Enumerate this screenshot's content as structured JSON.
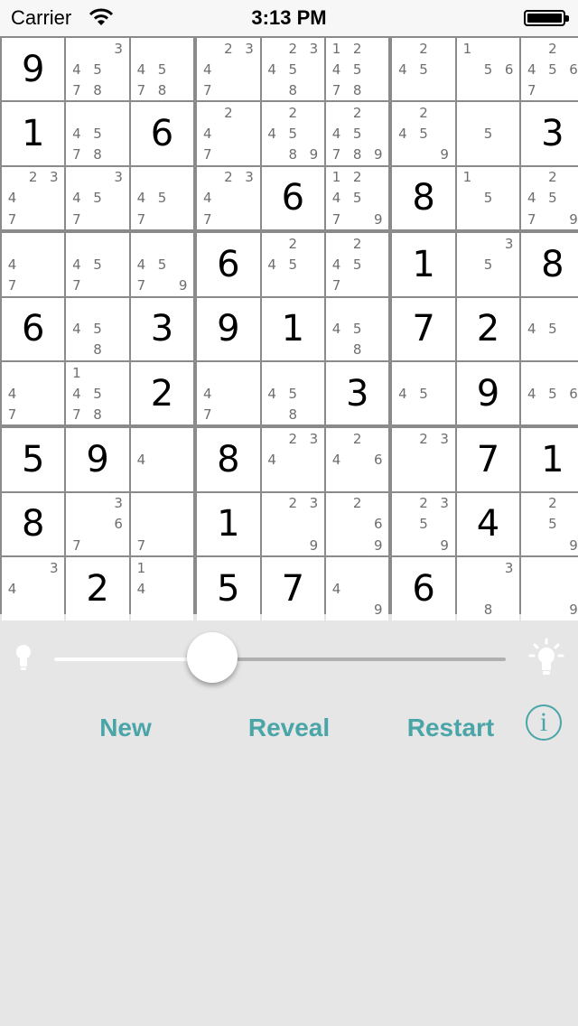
{
  "status_bar": {
    "carrier": "Carrier",
    "time": "3:13 PM"
  },
  "board": {
    "cells": [
      [
        {
          "v": "9"
        },
        {
          "n": [
            3,
            4,
            5,
            7,
            8
          ]
        },
        {
          "n": [
            4,
            5,
            7,
            8
          ]
        },
        {
          "n": [
            2,
            3,
            4,
            7
          ]
        },
        {
          "n": [
            2,
            3,
            4,
            5,
            8
          ]
        },
        {
          "n": [
            1,
            2,
            4,
            5,
            7,
            8
          ]
        },
        {
          "n": [
            2,
            4,
            5
          ]
        },
        {
          "n": [
            1,
            5,
            6
          ]
        },
        {
          "n": [
            2,
            4,
            5,
            6,
            7
          ]
        }
      ],
      [
        {
          "v": "1"
        },
        {
          "n": [
            4,
            5,
            7,
            8
          ]
        },
        {
          "v": "6"
        },
        {
          "n": [
            2,
            4,
            7
          ]
        },
        {
          "n": [
            2,
            4,
            5,
            8,
            9
          ]
        },
        {
          "n": [
            2,
            4,
            5,
            7,
            8,
            9
          ]
        },
        {
          "n": [
            2,
            4,
            5,
            9
          ]
        },
        {
          "n": [
            5
          ]
        },
        {
          "v": "3"
        }
      ],
      [
        {
          "n": [
            2,
            3,
            4,
            7
          ]
        },
        {
          "n": [
            3,
            4,
            5,
            7
          ]
        },
        {
          "n": [
            4,
            5,
            7
          ]
        },
        {
          "n": [
            2,
            3,
            4,
            7
          ]
        },
        {
          "v": "6"
        },
        {
          "n": [
            1,
            2,
            4,
            5,
            7,
            9
          ]
        },
        {
          "v": "8"
        },
        {
          "n": [
            1,
            5
          ]
        },
        {
          "n": [
            2,
            4,
            5,
            7,
            9
          ]
        }
      ],
      [
        {
          "n": [
            4,
            7
          ]
        },
        {
          "n": [
            4,
            5,
            7
          ]
        },
        {
          "n": [
            4,
            5,
            7,
            9
          ]
        },
        {
          "v": "6"
        },
        {
          "n": [
            2,
            4,
            5
          ]
        },
        {
          "n": [
            2,
            4,
            5,
            7
          ]
        },
        {
          "v": "1"
        },
        {
          "n": [
            3,
            5
          ]
        },
        {
          "v": "8"
        }
      ],
      [
        {
          "v": "6"
        },
        {
          "n": [
            4,
            5,
            8
          ]
        },
        {
          "v": "3"
        },
        {
          "v": "9"
        },
        {
          "v": "1"
        },
        {
          "n": [
            4,
            5,
            8
          ]
        },
        {
          "v": "7"
        },
        {
          "v": "2"
        },
        {
          "n": [
            4,
            5
          ]
        }
      ],
      [
        {
          "n": [
            4,
            7
          ]
        },
        {
          "n": [
            1,
            4,
            5,
            7,
            8
          ]
        },
        {
          "v": "2"
        },
        {
          "n": [
            4,
            7
          ]
        },
        {
          "n": [
            4,
            5,
            8
          ]
        },
        {
          "v": "3"
        },
        {
          "n": [
            4,
            5
          ]
        },
        {
          "v": "9"
        },
        {
          "n": [
            4,
            5,
            6
          ]
        }
      ],
      [
        {
          "v": "5"
        },
        {
          "v": "9"
        },
        {
          "n": [
            4
          ]
        },
        {
          "v": "8"
        },
        {
          "n": [
            2,
            3,
            4
          ]
        },
        {
          "n": [
            2,
            4,
            6
          ]
        },
        {
          "n": [
            2,
            3
          ]
        },
        {
          "v": "7"
        },
        {
          "v": "1"
        }
      ],
      [
        {
          "v": "8"
        },
        {
          "n": [
            3,
            6,
            7
          ]
        },
        {
          "n": [
            7
          ]
        },
        {
          "v": "1"
        },
        {
          "n": [
            2,
            3,
            9
          ]
        },
        {
          "n": [
            2,
            6,
            9
          ]
        },
        {
          "n": [
            2,
            3,
            5,
            9
          ]
        },
        {
          "v": "4"
        },
        {
          "n": [
            2,
            5,
            9
          ]
        }
      ],
      [
        {
          "n": [
            3,
            4
          ]
        },
        {
          "v": "2"
        },
        {
          "n": [
            1,
            4
          ]
        },
        {
          "v": "5"
        },
        {
          "v": "7"
        },
        {
          "n": [
            4,
            9
          ]
        },
        {
          "v": "6"
        },
        {
          "n": [
            3,
            8
          ]
        },
        {
          "n": [
            9
          ]
        }
      ]
    ]
  },
  "controls": {
    "brightness_level": 0.35,
    "new_label": "New",
    "reveal_label": "Reveal",
    "restart_label": "Restart",
    "info_label": "i"
  },
  "colors": {
    "accent": "#4aa5a8",
    "note": "#6e6e6e",
    "background": "#e6e6e6"
  }
}
